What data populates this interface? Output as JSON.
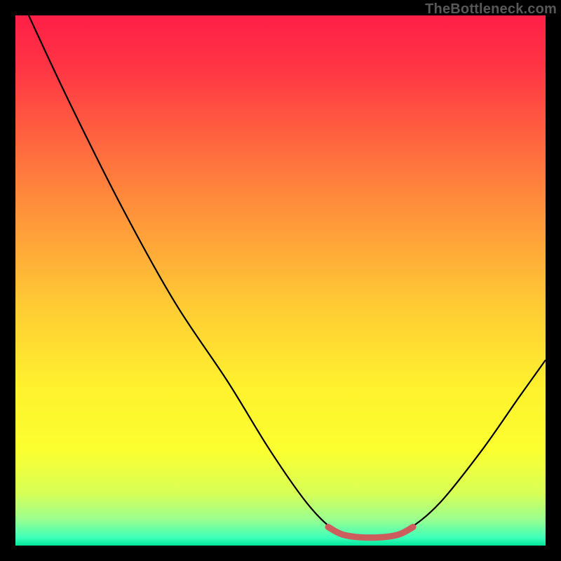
{
  "watermark": "TheBottleneck.com",
  "chart_data": {
    "type": "line",
    "title": "",
    "xlabel": "",
    "ylabel": "",
    "xlim": [
      0,
      100
    ],
    "ylim": [
      0,
      100
    ],
    "axes_visible": false,
    "grid": false,
    "legend": false,
    "background_gradient": {
      "stops": [
        {
          "offset": 0.0,
          "color": "#ff1f47"
        },
        {
          "offset": 0.1,
          "color": "#ff3544"
        },
        {
          "offset": 0.25,
          "color": "#ff6a3f"
        },
        {
          "offset": 0.4,
          "color": "#ff9c3a"
        },
        {
          "offset": 0.55,
          "color": "#ffcc34"
        },
        {
          "offset": 0.7,
          "color": "#fff12e"
        },
        {
          "offset": 0.82,
          "color": "#fbff2f"
        },
        {
          "offset": 0.9,
          "color": "#d8ff56"
        },
        {
          "offset": 0.95,
          "color": "#9cff8e"
        },
        {
          "offset": 0.985,
          "color": "#3effba"
        },
        {
          "offset": 1.0,
          "color": "#00e69a"
        }
      ]
    },
    "series": [
      {
        "name": "bottleneck-curve",
        "stroke": "#000000",
        "points": [
          {
            "x": 2.5,
            "y": 100.0
          },
          {
            "x": 10.0,
            "y": 84.0
          },
          {
            "x": 20.0,
            "y": 64.0
          },
          {
            "x": 30.0,
            "y": 46.0
          },
          {
            "x": 40.0,
            "y": 31.0
          },
          {
            "x": 48.0,
            "y": 18.0
          },
          {
            "x": 55.0,
            "y": 8.0
          },
          {
            "x": 60.0,
            "y": 3.0
          },
          {
            "x": 64.0,
            "y": 1.5
          },
          {
            "x": 70.0,
            "y": 1.5
          },
          {
            "x": 74.0,
            "y": 3.0
          },
          {
            "x": 80.0,
            "y": 8.0
          },
          {
            "x": 88.0,
            "y": 18.0
          },
          {
            "x": 95.0,
            "y": 28.0
          },
          {
            "x": 100.0,
            "y": 35.0
          }
        ]
      },
      {
        "name": "optimal-range-marker",
        "stroke": "#cd5c5c",
        "stroke_width_px": 9,
        "linecap": "round",
        "points": [
          {
            "x": 59.0,
            "y": 3.5
          },
          {
            "x": 62.0,
            "y": 2.0
          },
          {
            "x": 67.0,
            "y": 1.5
          },
          {
            "x": 72.0,
            "y": 2.0
          },
          {
            "x": 75.0,
            "y": 3.5
          }
        ]
      }
    ]
  }
}
